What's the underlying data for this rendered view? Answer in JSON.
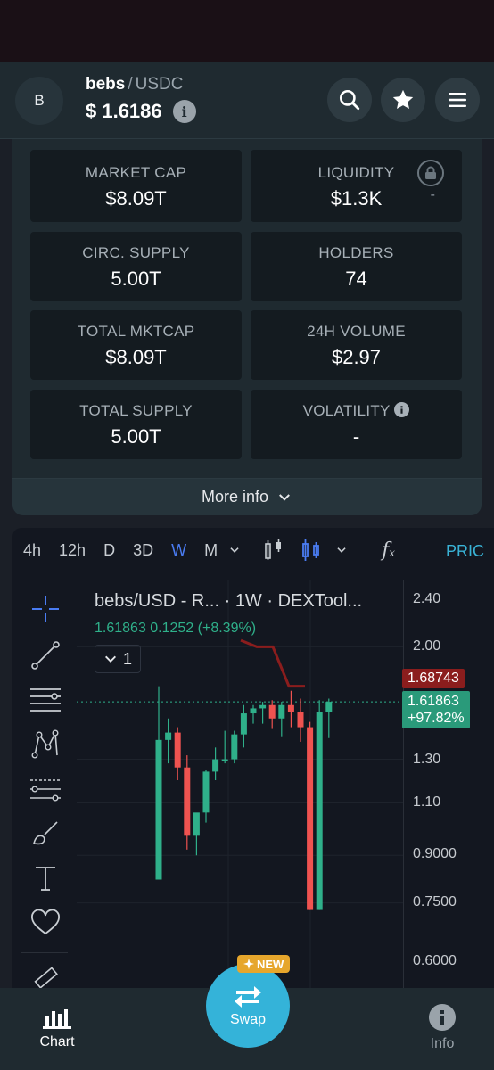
{
  "header": {
    "avatar_letter": "B",
    "base_symbol": "bebs",
    "separator": "/",
    "quote_symbol": "USDC",
    "price": "$ 1.6186",
    "info_glyph": "i"
  },
  "stats": [
    {
      "label": "MARKET CAP",
      "value": "$8.09T"
    },
    {
      "label": "LIQUIDITY",
      "value": "$1.3K",
      "extra": "-"
    },
    {
      "label": "CIRC. SUPPLY",
      "value": "5.00T"
    },
    {
      "label": "HOLDERS",
      "value": "74"
    },
    {
      "label": "TOTAL MKTCAP",
      "value": "$8.09T"
    },
    {
      "label": "24H VOLUME",
      "value": "$2.97"
    },
    {
      "label": "TOTAL SUPPLY",
      "value": "5.00T"
    },
    {
      "label": "VOLATILITY",
      "value": "-"
    }
  ],
  "more_info_label": "More info",
  "chart_toolbar": {
    "timeframes": [
      "4h",
      "12h",
      "D",
      "3D",
      "W",
      "M"
    ],
    "active_timeframe": "W",
    "price_tab": "PRIC"
  },
  "chart_legend": {
    "title": "bebs/USD - R...  · 1W · DEXTool...",
    "values": "1.61863  0.1252 (+8.39%)",
    "collapsed_count": "1"
  },
  "colors": {
    "up": "#2fb08a",
    "down": "#ef5350",
    "accent": "#34b3d9",
    "active_tab": "#4a7cf2"
  },
  "chart_data": {
    "type": "candlestick",
    "y_scale": "log",
    "price_ticks": [
      "2.40",
      "2.00",
      "1.30",
      "1.10",
      "0.9000",
      "0.7500",
      "0.6000"
    ],
    "last_price_tag": "1.61863",
    "last_change_tag": "+97.82%",
    "ref_price_tag": "1.68743",
    "candles": [
      {
        "o": 0.82,
        "h": 1.72,
        "l": 0.82,
        "c": 1.4
      },
      {
        "o": 1.4,
        "h": 1.52,
        "l": 1.28,
        "c": 1.44
      },
      {
        "o": 1.44,
        "h": 1.47,
        "l": 1.2,
        "c": 1.26
      },
      {
        "o": 1.26,
        "h": 1.32,
        "l": 0.92,
        "c": 0.97
      },
      {
        "o": 0.97,
        "h": 1.04,
        "l": 0.9,
        "c": 1.06
      },
      {
        "o": 1.06,
        "h": 1.25,
        "l": 1.02,
        "c": 1.24
      },
      {
        "o": 1.24,
        "h": 1.36,
        "l": 1.2,
        "c": 1.3
      },
      {
        "o": 1.3,
        "h": 1.45,
        "l": 1.28,
        "c": 1.3
      },
      {
        "o": 1.3,
        "h": 1.45,
        "l": 1.28,
        "c": 1.43
      },
      {
        "o": 1.43,
        "h": 1.6,
        "l": 1.36,
        "c": 1.55
      },
      {
        "o": 1.55,
        "h": 1.6,
        "l": 1.49,
        "c": 1.58
      },
      {
        "o": 1.58,
        "h": 1.62,
        "l": 1.49,
        "c": 1.6
      },
      {
        "o": 1.6,
        "h": 1.63,
        "l": 1.46,
        "c": 1.52
      },
      {
        "o": 1.52,
        "h": 1.62,
        "l": 1.42,
        "c": 1.6
      },
      {
        "o": 1.6,
        "h": 1.69,
        "l": 1.47,
        "c": 1.56
      },
      {
        "o": 1.56,
        "h": 1.64,
        "l": 1.39,
        "c": 1.47
      },
      {
        "o": 1.47,
        "h": 1.5,
        "l": 0.73,
        "c": 0.73
      },
      {
        "o": 0.73,
        "h": 1.63,
        "l": 0.73,
        "c": 1.56
      },
      {
        "o": 1.56,
        "h": 1.64,
        "l": 1.41,
        "c": 1.62
      }
    ],
    "overlay_line": [
      2.05,
      2.0,
      2.0,
      1.72,
      1.72
    ]
  },
  "nav": {
    "chart": "Chart",
    "swap": "Swap",
    "new_badge": "NEW",
    "info": "Info"
  }
}
